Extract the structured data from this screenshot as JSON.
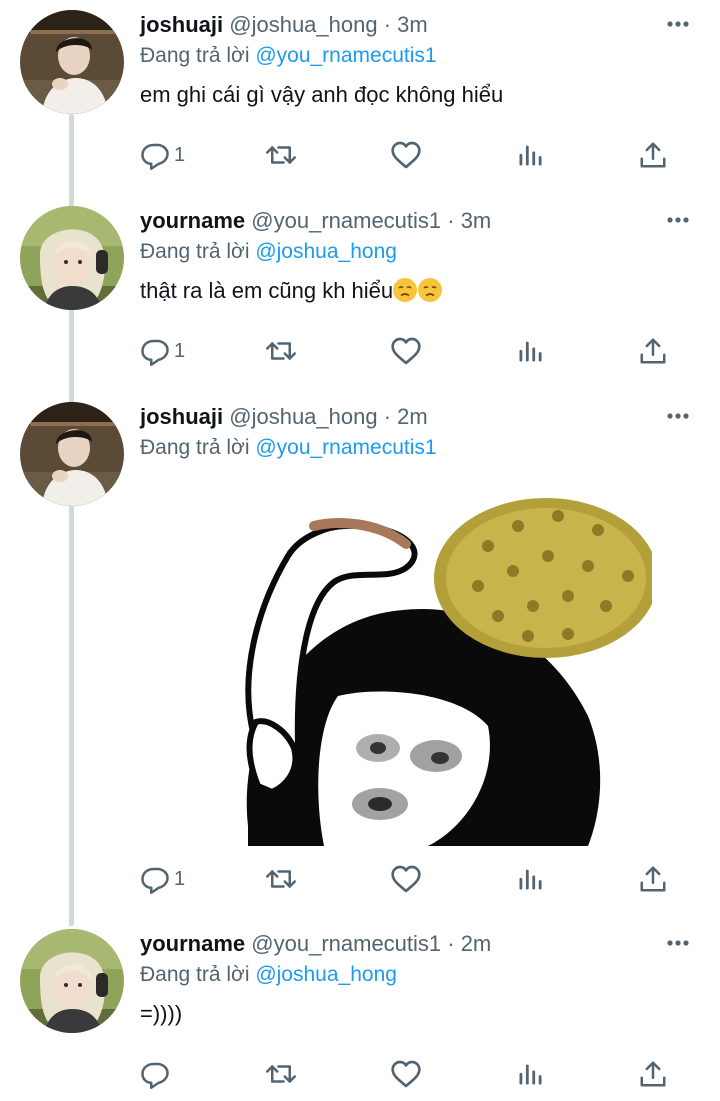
{
  "tweets": [
    {
      "author_name": "joshuaji",
      "author_handle": "@joshua_hong",
      "time": "3m",
      "meta": "@joshua_hong · 3m",
      "reply_prefix": "Đang trả lời",
      "reply_to": "@you_rnamecutis1",
      "text": "em ghi cái gì vậy anh đọc không hiểu",
      "reply_count": "1",
      "avatar": "joshuaji-avatar"
    },
    {
      "author_name": "yourname",
      "author_handle": "@you_rnamecutis1",
      "time": "3m",
      "meta": "@you_rnamecutis1 · 3m",
      "reply_prefix": "Đang trả lời",
      "reply_to": "@joshua_hong",
      "text": "thật ra là em cũng kh hiểu",
      "emoji": "disappointed-face-emoji x2",
      "reply_count": "1",
      "avatar": "yourname-avatar"
    },
    {
      "author_name": "joshuaji",
      "author_handle": "@joshua_hong",
      "time": "2m",
      "meta": "@joshua_hong · 2m",
      "reply_prefix": "Đang trả lời",
      "reply_to": "@you_rnamecutis1",
      "text": "",
      "media": "meme-image-durian-on-head",
      "reply_count": "1",
      "avatar": "joshuaji-avatar"
    },
    {
      "author_name": "yourname",
      "author_handle": "@you_rnamecutis1",
      "time": "2m",
      "meta": "@you_rnamecutis1 · 2m",
      "reply_prefix": "Đang trả lời",
      "reply_to": "@joshua_hong",
      "text": "=))))",
      "reply_count": "",
      "avatar": "yourname-avatar"
    }
  ],
  "icons": {
    "reply": "reply-icon",
    "retweet": "retweet-icon",
    "like": "like-icon",
    "views": "views-icon",
    "share": "share-icon",
    "more": "more-icon"
  },
  "colors": {
    "text": "#0f1419",
    "secondary": "#536471",
    "mention": "#1d9bf0",
    "thread_line": "#cfd9de"
  }
}
